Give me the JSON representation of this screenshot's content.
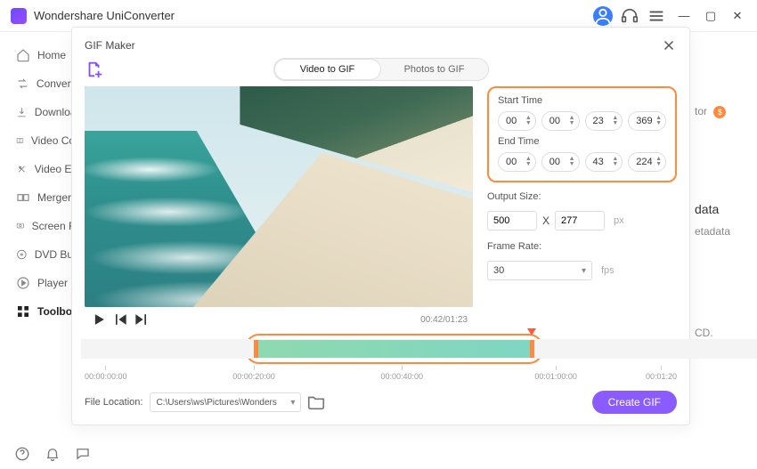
{
  "app_title": "Wondershare UniConverter",
  "titlebar": {
    "user_icon": "user-icon",
    "headset_icon": "headset-icon",
    "menu_icon": "hamburger-icon",
    "min": "—",
    "max": "▢",
    "close": "✕"
  },
  "sidebar": {
    "items": [
      {
        "icon": "home-icon",
        "label": "Home"
      },
      {
        "icon": "convert-icon",
        "label": "Converter"
      },
      {
        "icon": "download-icon",
        "label": "Downloader"
      },
      {
        "icon": "compress-icon",
        "label": "Video Compressor"
      },
      {
        "icon": "editor-icon",
        "label": "Video Editor"
      },
      {
        "icon": "merger-icon",
        "label": "Merger"
      },
      {
        "icon": "recorder-icon",
        "label": "Screen Recorder"
      },
      {
        "icon": "dvd-icon",
        "label": "DVD Burner"
      },
      {
        "icon": "player-icon",
        "label": "Player"
      },
      {
        "icon": "toolbox-icon",
        "label": "Toolbox"
      }
    ],
    "active_index": 9
  },
  "background_panel": {
    "tor_suffix": "tor",
    "pro_badge": "$",
    "data_label": "data",
    "metadata_label": "etadata",
    "cd_label": "CD."
  },
  "modal": {
    "title": "GIF Maker",
    "tabs": {
      "video": "Video to GIF",
      "photos": "Photos to GIF",
      "active": "video"
    },
    "player": {
      "time": "00:42/01:23"
    },
    "settings": {
      "start_label": "Start Time",
      "start": {
        "h": "00",
        "m": "00",
        "s": "23",
        "ms": "369"
      },
      "end_label": "End Time",
      "end": {
        "h": "00",
        "m": "00",
        "s": "43",
        "ms": "224"
      },
      "output_size_label": "Output Size:",
      "output_w": "500",
      "output_x": "X",
      "output_h": "277",
      "output_unit": "px",
      "frame_rate_label": "Frame Rate:",
      "frame_rate": "30",
      "frame_rate_unit": "fps"
    },
    "timeline": {
      "ticks": [
        "00:00:00:00",
        "00:00:20:00",
        "00:00:40:00",
        "00:01:00:00",
        "00:01:20"
      ]
    },
    "footer": {
      "location_label": "File Location:",
      "location_value": "C:\\Users\\ws\\Pictures\\Wonders",
      "create_label": "Create GIF"
    }
  }
}
